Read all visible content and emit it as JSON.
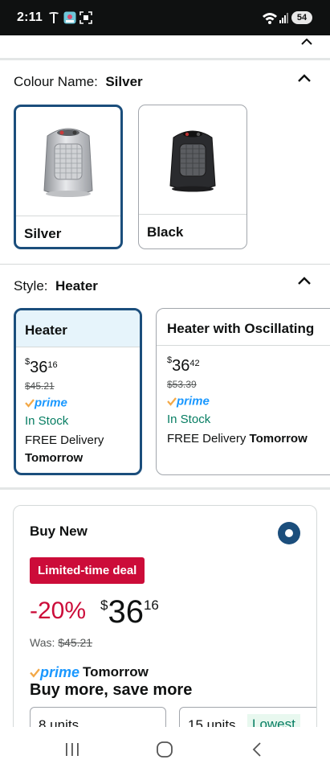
{
  "status_bar": {
    "time": "2:11",
    "battery": "54"
  },
  "colour": {
    "label": "Colour Name:",
    "selected": "Silver",
    "options": [
      {
        "label": "Silver"
      },
      {
        "label": "Black"
      }
    ]
  },
  "style": {
    "label": "Style:",
    "selected": "Heater",
    "options": [
      {
        "title": "Heater",
        "currency": "$",
        "price_whole": "36",
        "price_fraction": "16",
        "was": "$45.21",
        "prime": "prime",
        "stock": "In Stock",
        "delivery_prefix": "FREE Delivery",
        "delivery_day": "Tomorrow"
      },
      {
        "title": "Heater with Oscillating",
        "currency": "$",
        "price_whole": "36",
        "price_fraction": "42",
        "was": "$53.39",
        "prime": "prime",
        "stock": "In Stock",
        "delivery_prefix": "FREE Delivery",
        "delivery_day": "Tomorrow"
      }
    ]
  },
  "buy_box": {
    "title": "Buy New",
    "deal_badge": "Limited-time deal",
    "discount": "-20%",
    "currency": "$",
    "price_whole": "36",
    "price_fraction": "16",
    "was_label": "Was:",
    "was_price": "$45.21",
    "prime": "prime",
    "delivery_day": "Tomorrow",
    "buy_more": "Buy more, save more",
    "units": [
      {
        "label": "8 units"
      },
      {
        "label": "15 units",
        "badge": "Lowest"
      }
    ]
  },
  "colors": {
    "selected_border": "#1b4e7c",
    "deal_red": "#cc0c39",
    "stock_green": "#067d62",
    "prime_blue": "#1a98ff"
  }
}
